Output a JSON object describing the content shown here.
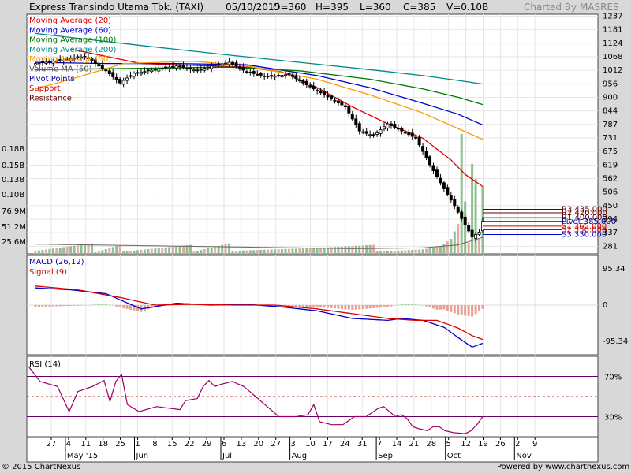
{
  "header": {
    "title": "Express Transindo Utama Tbk. (TAXI)",
    "date": "05/10/2015",
    "open": "O=360",
    "high": "H=395",
    "low": "L=360",
    "close": "C=385",
    "volume": "V=0.10B",
    "brand": "Charted By MASRES"
  },
  "footer": {
    "copyright": "© 2015 ChartNexus",
    "powered": "Powered by www.chartnexus.com"
  },
  "chart_data": [
    {
      "type": "candlestick",
      "panel": "price",
      "legend": [
        {
          "label": "Moving Average (20)",
          "color": "#e00000"
        },
        {
          "label": "Moving Average (60)",
          "color": "#0000cc"
        },
        {
          "label": "Moving Average (100)",
          "color": "#007700"
        },
        {
          "label": "Moving Average (200)",
          "color": "#008888"
        },
        {
          "label": "Moving Average (50)",
          "color": "#ff9900"
        },
        {
          "label": "Volume MA (50)",
          "color": "#555555"
        },
        {
          "label": "Pivot Points",
          "color": "#000099"
        },
        {
          "label": "Support",
          "color": "#cc0000"
        },
        {
          "label": "Resistance",
          "color": "#660000"
        }
      ],
      "y_ticks": [
        "1237",
        "1181",
        "1124",
        "1068",
        "1012",
        "956",
        "900",
        "844",
        "787",
        "731",
        "675",
        "619",
        "562",
        "506",
        "450",
        "394",
        "337",
        "281"
      ],
      "volume_ticks": [
        "0.18B",
        "0.15B",
        "0.13B",
        "0.10B",
        "76.9M",
        "51.2M",
        "25.6M"
      ],
      "ylim": [
        250,
        1245
      ],
      "x_ticks": [
        "27",
        "4",
        "11",
        "18",
        "25",
        "1",
        "8",
        "15",
        "22",
        "29",
        "6",
        "13",
        "20",
        "27",
        "3",
        "10",
        "17",
        "24",
        "31",
        "7",
        "14",
        "21",
        "28",
        "5",
        "12",
        "19",
        "26",
        "2",
        "9"
      ],
      "month_labels": [
        {
          "label": "May '15",
          "index": 1
        },
        {
          "label": "Jun",
          "index": 5
        },
        {
          "label": "Jul",
          "index": 10
        },
        {
          "label": "Aug",
          "index": 14
        },
        {
          "label": "Sep",
          "index": 19
        },
        {
          "label": "Oct",
          "index": 23
        },
        {
          "label": "Nov",
          "index": 27
        }
      ],
      "pivot_levels": [
        {
          "label": "R3 435.000",
          "value": 435,
          "color": "#660000"
        },
        {
          "label": "R2 420.000",
          "value": 420,
          "color": "#660000"
        },
        {
          "label": "R1 400.000",
          "value": 400,
          "color": "#660000"
        },
        {
          "label": "Pivot 385.000",
          "value": 385,
          "color": "#000099"
        },
        {
          "label": "S1 365.000",
          "value": 365,
          "color": "#cc0000"
        },
        {
          "label": "S2 350.000",
          "value": 350,
          "color": "#cc0000"
        },
        {
          "label": "S3 330.000",
          "value": 330,
          "color": "#0000cc"
        }
      ],
      "close_anchors": [
        [
          0,
          1040
        ],
        [
          8,
          1055
        ],
        [
          14,
          1070
        ],
        [
          20,
          1010
        ],
        [
          24,
          960
        ],
        [
          28,
          1000
        ],
        [
          34,
          1015
        ],
        [
          40,
          1030
        ],
        [
          46,
          1010
        ],
        [
          50,
          1030
        ],
        [
          55,
          1045
        ],
        [
          60,
          1005
        ],
        [
          66,
          985
        ],
        [
          72,
          995
        ],
        [
          76,
          960
        ],
        [
          82,
          910
        ],
        [
          88,
          860
        ],
        [
          92,
          760
        ],
        [
          96,
          740
        ],
        [
          100,
          790
        ],
        [
          104,
          760
        ],
        [
          108,
          730
        ],
        [
          112,
          620
        ],
        [
          116,
          520
        ],
        [
          119,
          450
        ],
        [
          122,
          370
        ],
        [
          124,
          320
        ],
        [
          126,
          340
        ],
        [
          127,
          385
        ]
      ],
      "ma_series": [
        {
          "name": "MA20",
          "color": "#e00000",
          "points": [
            [
              10,
              1100
            ],
            [
              30,
              1040
            ],
            [
              50,
              1030
            ],
            [
              60,
              1025
            ],
            [
              70,
              1005
            ],
            [
              80,
              940
            ],
            [
              90,
              860
            ],
            [
              100,
              790
            ],
            [
              110,
              730
            ],
            [
              118,
              640
            ],
            [
              122,
              580
            ],
            [
              127,
              530
            ]
          ]
        },
        {
          "name": "MA60",
          "color": "#0000cc",
          "points": [
            [
              0,
              1045
            ],
            [
              20,
              1040
            ],
            [
              40,
              1040
            ],
            [
              60,
              1035
            ],
            [
              80,
              990
            ],
            [
              95,
              940
            ],
            [
              110,
              875
            ],
            [
              120,
              830
            ],
            [
              127,
              785
            ]
          ]
        },
        {
          "name": "MA100",
          "color": "#007700",
          "points": [
            [
              0,
              1015
            ],
            [
              30,
              1020
            ],
            [
              55,
              1025
            ],
            [
              75,
              1010
            ],
            [
              95,
              975
            ],
            [
              110,
              935
            ],
            [
              120,
              900
            ],
            [
              127,
              870
            ]
          ]
        },
        {
          "name": "MA200",
          "color": "#008888",
          "points": [
            [
              0,
              1165
            ],
            [
              30,
              1115
            ],
            [
              55,
              1075
            ],
            [
              75,
              1045
            ],
            [
              95,
              1015
            ],
            [
              110,
              990
            ],
            [
              120,
              970
            ],
            [
              127,
              955
            ]
          ]
        },
        {
          "name": "MA50",
          "color": "#ff9900",
          "points": [
            [
              0,
              935
            ],
            [
              10,
              975
            ],
            [
              25,
              1040
            ],
            [
              45,
              1050
            ],
            [
              60,
              1030
            ],
            [
              80,
              975
            ],
            [
              95,
              910
            ],
            [
              110,
              835
            ],
            [
              120,
              770
            ],
            [
              127,
              725
            ]
          ]
        }
      ],
      "volume_anchors": [
        [
          0,
          4
        ],
        [
          16,
          14
        ],
        [
          17,
          2
        ],
        [
          24,
          12
        ],
        [
          25,
          3
        ],
        [
          44,
          12
        ],
        [
          45,
          3
        ],
        [
          55,
          14
        ],
        [
          56,
          4
        ],
        [
          80,
          8
        ],
        [
          96,
          12
        ],
        [
          97,
          3
        ],
        [
          110,
          6
        ],
        [
          115,
          10
        ],
        [
          118,
          20
        ],
        [
          120,
          40
        ],
        [
          121,
          160
        ],
        [
          122,
          70
        ],
        [
          123,
          15
        ],
        [
          124,
          120
        ],
        [
          125,
          100
        ],
        [
          126,
          20
        ],
        [
          127,
          90
        ]
      ],
      "volume_ma": [
        [
          0,
          13
        ],
        [
          30,
          11
        ],
        [
          60,
          9
        ],
        [
          90,
          7
        ],
        [
          110,
          8
        ],
        [
          120,
          12
        ],
        [
          127,
          22
        ]
      ]
    },
    {
      "type": "line",
      "panel": "macd",
      "title": "MACD (26,12)",
      "signal_label": "Signal (9)",
      "y_ticks": [
        "95.34",
        "0",
        "-95.34"
      ],
      "ylim": [
        -130,
        130
      ],
      "macd_anchors": [
        [
          0,
          45
        ],
        [
          10,
          40
        ],
        [
          20,
          30
        ],
        [
          30,
          -10
        ],
        [
          40,
          5
        ],
        [
          50,
          0
        ],
        [
          60,
          2
        ],
        [
          70,
          -5
        ],
        [
          80,
          -15
        ],
        [
          90,
          -35
        ],
        [
          100,
          -40
        ],
        [
          104,
          -35
        ],
        [
          110,
          -40
        ],
        [
          116,
          -58
        ],
        [
          120,
          -85
        ],
        [
          124,
          -110
        ],
        [
          127,
          -100
        ]
      ],
      "signal_anchors": [
        [
          0,
          50
        ],
        [
          12,
          40
        ],
        [
          24,
          20
        ],
        [
          34,
          0
        ],
        [
          44,
          2
        ],
        [
          56,
          0
        ],
        [
          68,
          0
        ],
        [
          80,
          -10
        ],
        [
          92,
          -25
        ],
        [
          100,
          -35
        ],
        [
          108,
          -40
        ],
        [
          114,
          -40
        ],
        [
          120,
          -60
        ],
        [
          124,
          -80
        ],
        [
          127,
          -90
        ]
      ]
    },
    {
      "type": "line",
      "panel": "rsi",
      "title": "RSI (14)",
      "y_ticks": [
        "70%",
        "30%"
      ],
      "ylim": [
        10,
        90
      ],
      "levels": [
        70,
        50,
        30
      ],
      "rsi_anchors": [
        [
          0,
          80
        ],
        [
          4,
          65
        ],
        [
          10,
          60
        ],
        [
          14,
          35
        ],
        [
          17,
          55
        ],
        [
          22,
          60
        ],
        [
          26,
          66
        ],
        [
          28,
          45
        ],
        [
          30,
          65
        ],
        [
          32,
          72
        ],
        [
          34,
          42
        ],
        [
          38,
          35
        ],
        [
          44,
          40
        ],
        [
          52,
          37
        ],
        [
          54,
          46
        ],
        [
          58,
          48
        ],
        [
          60,
          60
        ],
        [
          62,
          66
        ],
        [
          64,
          60
        ],
        [
          66,
          62
        ],
        [
          70,
          65
        ],
        [
          74,
          60
        ],
        [
          78,
          50
        ],
        [
          82,
          40
        ],
        [
          86,
          30
        ],
        [
          92,
          30
        ],
        [
          96,
          32
        ],
        [
          98,
          42
        ],
        [
          100,
          25
        ],
        [
          104,
          22
        ],
        [
          108,
          22
        ],
        [
          112,
          30
        ],
        [
          116,
          30
        ],
        [
          120,
          38
        ],
        [
          122,
          40
        ],
        [
          124,
          35
        ],
        [
          126,
          30
        ],
        [
          128,
          32
        ],
        [
          130,
          28
        ],
        [
          132,
          20
        ],
        [
          134,
          18
        ],
        [
          137,
          16
        ],
        [
          139,
          20
        ],
        [
          141,
          20
        ],
        [
          143,
          16
        ],
        [
          146,
          14
        ],
        [
          150,
          13
        ],
        [
          152,
          16
        ],
        [
          154,
          22
        ],
        [
          156,
          30
        ]
      ]
    }
  ]
}
